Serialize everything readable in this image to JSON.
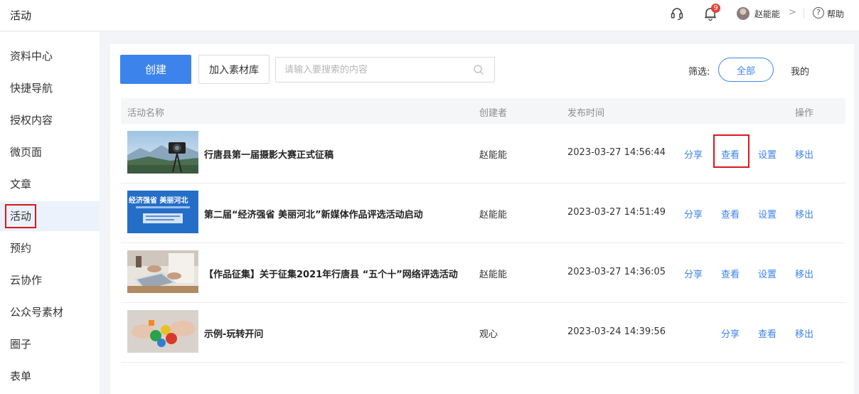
{
  "topbar": {
    "title": "活动",
    "notification_count": "9",
    "user_name": "赵能能",
    "help_label": "帮助",
    "help_icon": "?",
    "chevron": ">"
  },
  "sidebar": {
    "items": [
      {
        "label": "资料中心"
      },
      {
        "label": "快捷导航"
      },
      {
        "label": "授权内容"
      },
      {
        "label": "微页面"
      },
      {
        "label": "文章"
      },
      {
        "label": "活动"
      },
      {
        "label": "预约"
      },
      {
        "label": "云协作"
      },
      {
        "label": "公众号素材"
      },
      {
        "label": "圈子"
      },
      {
        "label": "表单"
      }
    ],
    "active_index": 5
  },
  "toolbar": {
    "create_label": "创建",
    "add_library_label": "加入素材库",
    "search_placeholder": "请输入要搜索的内容",
    "filter_label": "筛选:",
    "filter_all": "全部",
    "filter_mine": "我的"
  },
  "table": {
    "headers": {
      "name": "活动名称",
      "creator": "创建者",
      "time": "发布时间",
      "actions": "操作"
    },
    "rows": [
      {
        "title": "行唐县第一届摄影大赛正式征稿",
        "creator": "赵能能",
        "time": "2023-03-27 14:56:44",
        "actions": [
          "分享",
          "查看",
          "设置",
          "移出"
        ]
      },
      {
        "title": "第二届“经济强省 美丽河北”新媒体作品评选活动启动",
        "creator": "赵能能",
        "time": "2023-03-27 14:51:49",
        "thumb_text": "经济强省  美丽河北",
        "actions": [
          "分享",
          "查看",
          "设置",
          "移出"
        ]
      },
      {
        "title": "【作品征集】关于征集2021年行唐县 “五个十”网络评选活动",
        "creator": "赵能能",
        "time": "2023-03-27 14:36:05",
        "actions": [
          "分享",
          "查看",
          "设置",
          "移出"
        ]
      },
      {
        "title": "示例-玩转开问",
        "creator": "观心",
        "time": "2023-03-24 14:39:56",
        "actions": [
          "分享",
          "查看",
          "移出"
        ]
      }
    ]
  },
  "colors": {
    "accent": "#3d83ec",
    "highlight": "#d9181e",
    "badge": "#e5413b"
  }
}
